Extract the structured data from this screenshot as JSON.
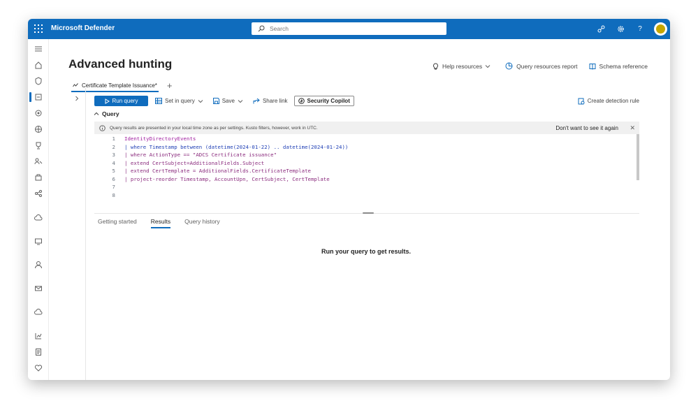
{
  "app": {
    "title": "Microsoft Defender"
  },
  "search": {
    "placeholder": "Search"
  },
  "page": {
    "title": "Advanced hunting"
  },
  "header_actions": {
    "help": "Help resources",
    "resources_report": "Query resources report",
    "schema": "Schema reference"
  },
  "tabs": [
    {
      "label": "Certificate Template Issuance*"
    }
  ],
  "toolbar": {
    "run": "Run query",
    "set_in_query": "Set in query",
    "save": "Save",
    "share": "Share link",
    "copilot": "Security Copilot",
    "detection": "Create detection rule"
  },
  "query_section": {
    "label": "Query"
  },
  "infobar": {
    "text": "Query results are presented in your local time zone as per settings. Kusto filters, however, work in UTC.",
    "dismiss": "Don't want to see it again"
  },
  "editor": {
    "line_numbers": [
      "1",
      "2",
      "3",
      "4",
      "5",
      "6",
      "7",
      "8"
    ],
    "lines": [
      "IdentityDirectoryEvents",
      "| where Timestamp between (datetime(2024-01-22) .. datetime(2024-01-24))",
      "| where ActionType == \"ADCS Certificate issuance\"",
      "| extend CertSubject=AdditionalFields.Subject",
      "| extend CertTemplate = AdditionalFields.CertificateTemplate",
      "| project-reorder Timestamp, AccountUpn, CertSubject, CertTemplate",
      "",
      ""
    ]
  },
  "result_tabs": [
    "Getting started",
    "Results",
    "Query history"
  ],
  "active_result_tab": "Results",
  "results": {
    "empty_message": "Run your query to get results."
  },
  "colors": {
    "accent": "#0f6cbd",
    "keyword": "#0000ff",
    "string": "#a31515",
    "table": "#a020a0"
  },
  "rail_icons": [
    "menu-icon",
    "home-icon",
    "shield-icon",
    "incidents-icon",
    "hunting-icon",
    "threat-intel-icon",
    "trophy-icon",
    "partners-icon",
    "assets-icon",
    "exposure-icon",
    "cloud-apps-icon",
    "endpoints-icon",
    "identities-icon",
    "email-icon",
    "cloud-icon",
    "reports-icon",
    "audit-icon",
    "health-icon"
  ]
}
